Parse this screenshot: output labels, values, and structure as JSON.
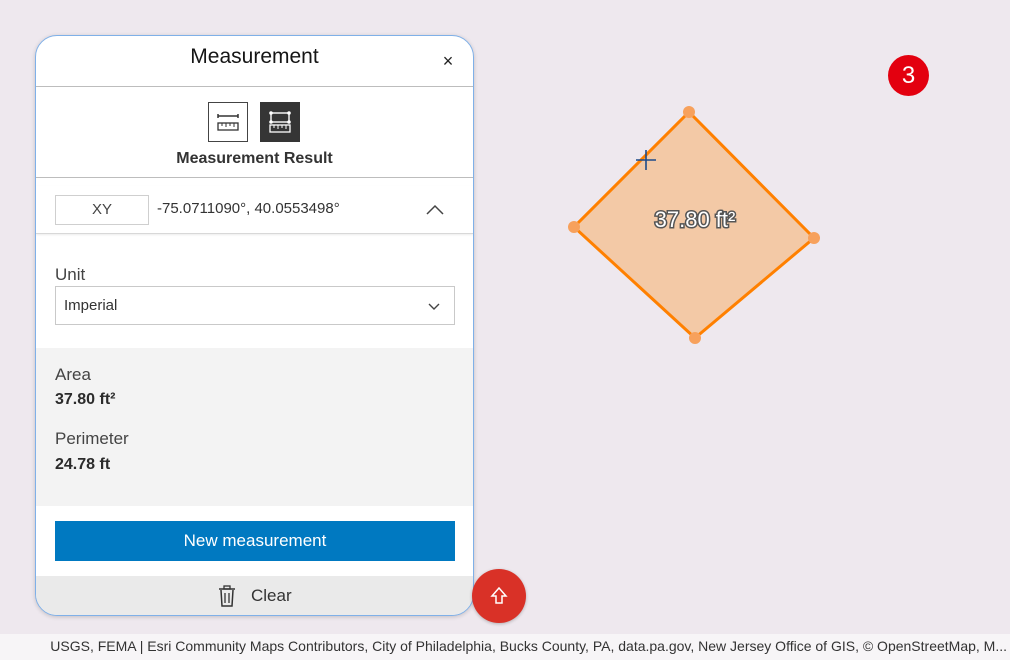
{
  "panel": {
    "title": "Measurement",
    "close_glyph": "×",
    "tools": [
      {
        "name": "distance",
        "icon": "ruler-distance-icon",
        "active": false
      },
      {
        "name": "area",
        "icon": "ruler-area-icon",
        "active": true
      }
    ],
    "result_heading": "Measurement Result",
    "coordinate": {
      "format_label": "XY",
      "value": "-75.0711090°, 40.0553498°"
    },
    "unit": {
      "label": "Unit",
      "selected": "Imperial"
    },
    "results": {
      "area_label": "Area",
      "area_value": "37.80 ft²",
      "perimeter_label": "Perimeter",
      "perimeter_value": "24.78 ft"
    },
    "new_measurement_label": "New measurement",
    "clear_label": "Clear"
  },
  "map": {
    "shape_label": "37.80 ft²",
    "badge_number": "3",
    "attribution": "USGS, FEMA | Esri Community Maps Contributors, City of Philadelphia, Bucks County, PA, data.pa.gov, New Jersey Office of GIS, © OpenStreetMap, M..."
  },
  "colors": {
    "accent": "#0079c1",
    "fab": "#d93127",
    "badge": "#e3000f",
    "polygon_fill": "#f3c9a6",
    "polygon_stroke": "#ff8000",
    "panel_border": "#7fb0e8"
  }
}
